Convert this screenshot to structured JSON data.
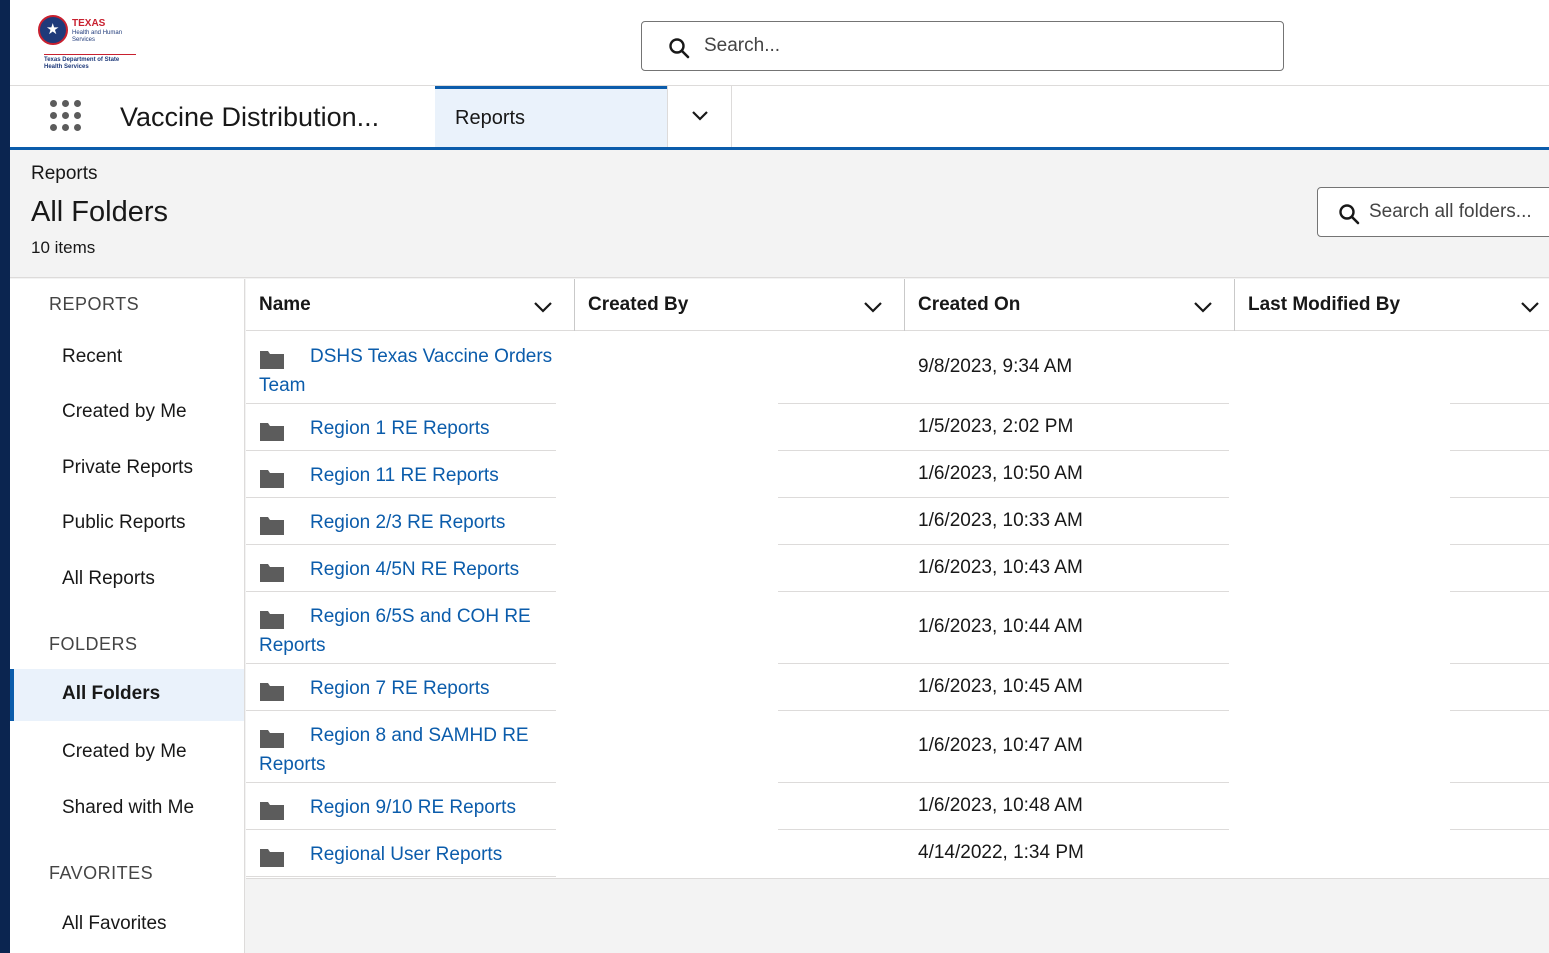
{
  "header": {
    "logo": {
      "title": "TEXAS",
      "subtitle": "Health and Human Services",
      "department": "Texas Department of State Health Services"
    },
    "search_placeholder": "Search..."
  },
  "nav": {
    "app_name": "Vaccine Distribution...",
    "active_tab": "Reports"
  },
  "page": {
    "breadcrumb": "Reports",
    "title": "All Folders",
    "count": "10 items",
    "folder_search_placeholder": "Search all folders..."
  },
  "sidebar": {
    "reports_heading": "REPORTS",
    "reports_items": [
      "Recent",
      "Created by Me",
      "Private Reports",
      "Public Reports",
      "All Reports"
    ],
    "folders_heading": "FOLDERS",
    "folders_items": [
      "All Folders",
      "Created by Me",
      "Shared with Me"
    ],
    "favorites_heading": "FAVORITES",
    "favorites_items": [
      "All Favorites"
    ],
    "active_item": "All Folders"
  },
  "table": {
    "columns": [
      "Name",
      "Created By",
      "Created On",
      "Last Modified By"
    ],
    "rows": [
      {
        "name": "DSHS Texas Vaccine Orders Team",
        "created_on": "9/8/2023, 9:34 AM"
      },
      {
        "name": "Region 1 RE Reports",
        "created_on": "1/5/2023, 2:02 PM"
      },
      {
        "name": "Region 11 RE Reports",
        "created_on": "1/6/2023, 10:50 AM"
      },
      {
        "name": "Region 2/3 RE Reports",
        "created_on": "1/6/2023, 10:33 AM"
      },
      {
        "name": "Region 4/5N RE Reports",
        "created_on": "1/6/2023, 10:43 AM"
      },
      {
        "name": "Region 6/5S and COH RE Reports",
        "created_on": "1/6/2023, 10:44 AM"
      },
      {
        "name": "Region 7 RE Reports",
        "created_on": "1/6/2023, 10:45 AM"
      },
      {
        "name": "Region 8 and SAMHD RE Reports",
        "created_on": "1/6/2023, 10:47 AM"
      },
      {
        "name": "Region 9/10 RE Reports",
        "created_on": "1/6/2023, 10:48 AM"
      },
      {
        "name": "Regional User Reports",
        "created_on": "4/14/2022, 1:34 PM"
      }
    ]
  },
  "icons": {
    "search": "search-icon",
    "app_launcher": "waffle-icon",
    "chevron": "chevron-down-icon",
    "folder": "folder-icon"
  },
  "colors": {
    "brand_blue": "#0b5cab",
    "link": "#0b5cab",
    "outer_frame": "#0b2550",
    "active_bg": "#eaf2fb"
  }
}
